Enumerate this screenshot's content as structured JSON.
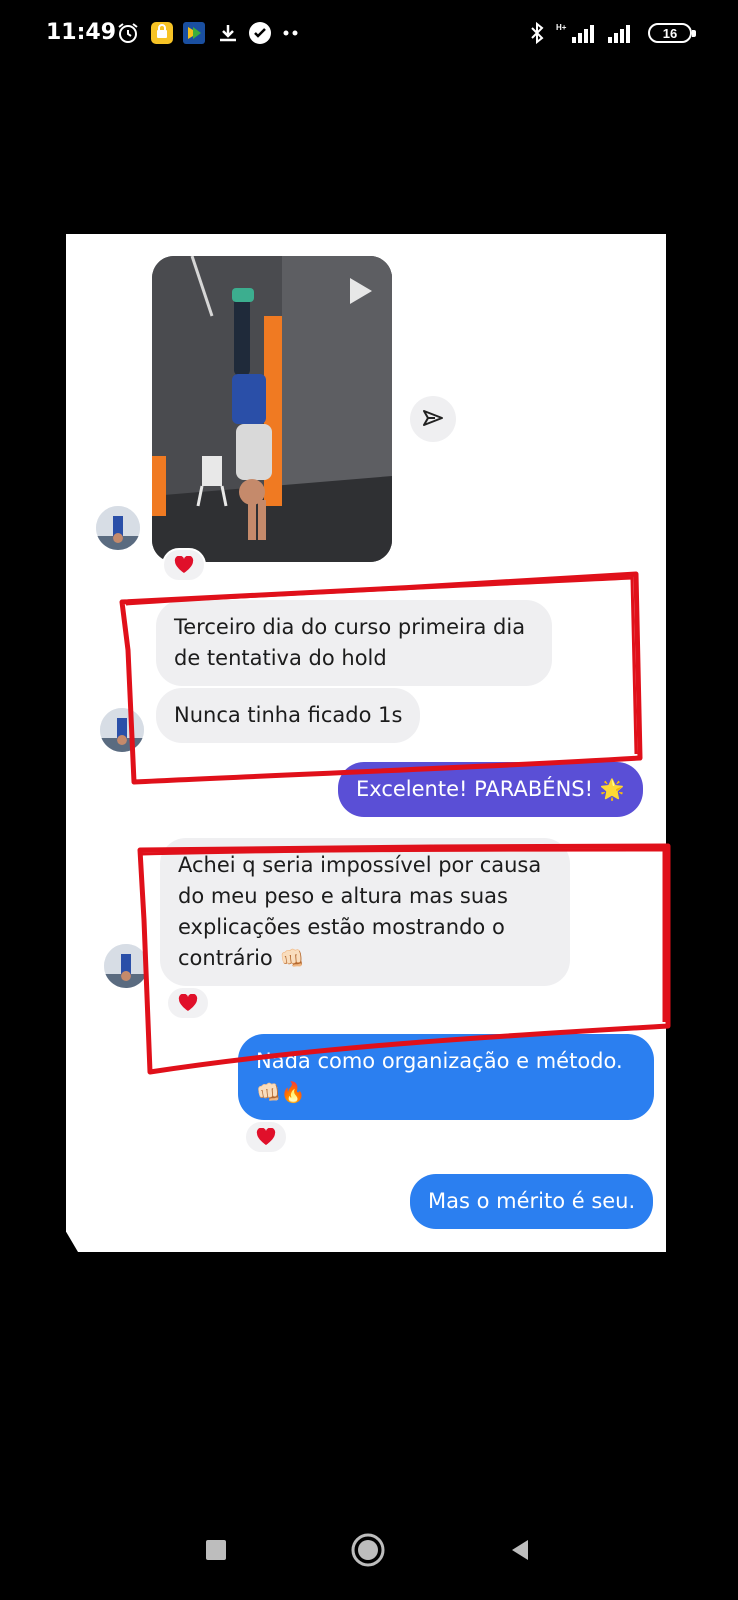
{
  "status_bar": {
    "time": "11:49",
    "battery": "16",
    "network": "H+",
    "icons": [
      "alarm-icon",
      "app-icon",
      "app-icon",
      "download-icon",
      "check-icon",
      "more-dots-icon",
      "bluetooth-icon",
      "signal-icon",
      "signal-icon",
      "battery-icon"
    ]
  },
  "chat": {
    "messages": [
      {
        "id": "m1",
        "type": "video",
        "sender": "contact",
        "reaction": "❤"
      },
      {
        "id": "m2",
        "sender": "contact",
        "text": "Terceiro dia do curso primeira dia de tentativa do hold"
      },
      {
        "id": "m3",
        "sender": "contact",
        "text": "Nunca tinha ficado 1s"
      },
      {
        "id": "m4",
        "sender": "me",
        "text": "Excelente! PARABÉNS!",
        "emoji": "🌟"
      },
      {
        "id": "m5",
        "sender": "contact",
        "text": "Achei q seria impossível por causa do meu peso e altura mas suas explicações estão mostrando o contrário",
        "emoji": "👊🏻",
        "reaction": "❤"
      },
      {
        "id": "m6",
        "sender": "me",
        "text": "Nada como organização e método.",
        "emoji": "👊🏻🔥",
        "reaction": "❤"
      },
      {
        "id": "m7",
        "sender": "me",
        "text": "Mas o mérito é seu."
      }
    ]
  },
  "colors": {
    "incoming_bubble": "#efeff1",
    "outgoing_purple": "#5a4fd6",
    "outgoing_blue": "#2b7ff0",
    "highlight_outline": "#e0101a",
    "heart": "#e0102a"
  }
}
